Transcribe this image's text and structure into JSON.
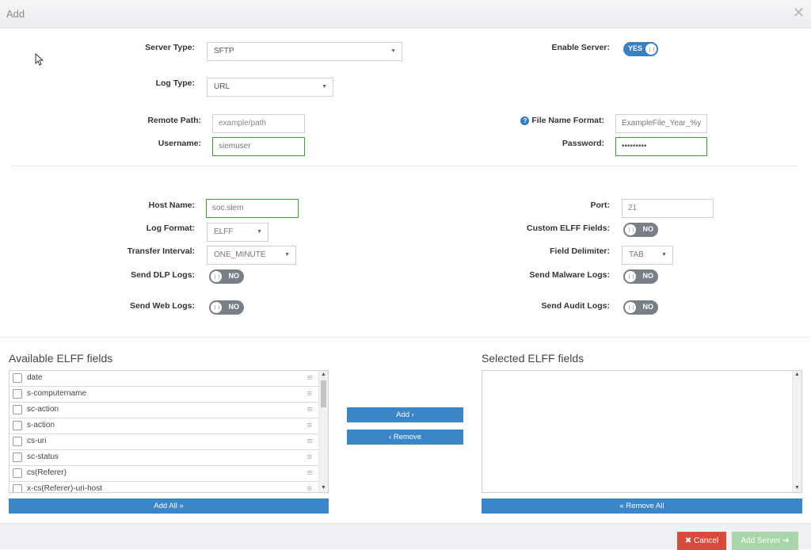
{
  "dialog": {
    "title": "Add",
    "close_glyph": "✕"
  },
  "form": {
    "server_type": {
      "label": "Server Type:",
      "value": "SFTP"
    },
    "enable_server": {
      "label": "Enable Server:",
      "state": "YES"
    },
    "log_type": {
      "label": "Log Type:",
      "value": "URL"
    },
    "remote_path": {
      "label": "Remote Path:",
      "placeholder": "example/path"
    },
    "file_name_format": {
      "label": "File Name Format:",
      "value": "ExampleFile_Year_%y"
    },
    "username": {
      "label": "Username:",
      "value": "siemuser"
    },
    "password": {
      "label": "Password:",
      "value": "•••••••••"
    },
    "host_name": {
      "label": "Host Name:",
      "value": "soc.siem"
    },
    "port": {
      "label": "Port:",
      "placeholder": "21"
    },
    "log_format": {
      "label": "Log Format:",
      "value": "ELFF"
    },
    "custom_elff_fields": {
      "label": "Custom ELFF Fields:",
      "state": "NO"
    },
    "transfer_interval": {
      "label": "Transfer Interval:",
      "value": "ONE_MINUTE"
    },
    "field_delimiter": {
      "label": "Field Delimiter:",
      "value": "TAB"
    },
    "send_dlp_logs": {
      "label": "Send DLP Logs:",
      "state": "NO"
    },
    "send_malware_logs": {
      "label": "Send Malware Logs:",
      "state": "NO"
    },
    "send_web_logs": {
      "label": "Send Web Logs:",
      "state": "NO"
    },
    "send_audit_logs": {
      "label": "Send Audit Logs:",
      "state": "NO"
    }
  },
  "fields": {
    "available_title": "Available ELFF fields",
    "selected_title": "Selected ELFF fields",
    "available": [
      "date",
      "s-computername",
      "sc-action",
      "s-action",
      "cs-uri",
      "sc-status",
      "cs(Referer)",
      "x-cs(Referer)-uri-host"
    ],
    "add_label": "Add ›",
    "remove_label": "‹ Remove",
    "add_all_label": "Add All »",
    "remove_all_label": "« Remove All"
  },
  "footer": {
    "cancel_label": "✖ Cancel",
    "add_server_label": "Add Server ➔"
  },
  "icons": {
    "drag": "≡",
    "caret": "▼",
    "help": "?"
  },
  "colors": {
    "accent": "#3a86c8",
    "valid_border": "#3c9b3c",
    "cancel": "#d84a3c",
    "add_server_disabled": "#a8d6a8"
  }
}
